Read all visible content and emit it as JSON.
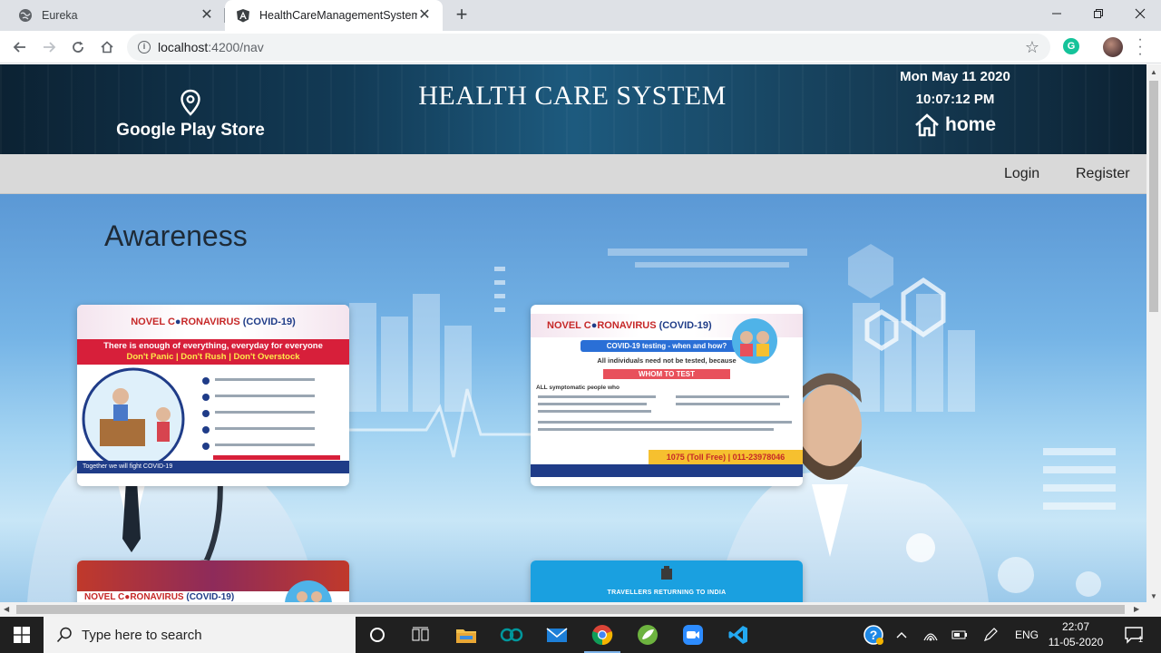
{
  "browser": {
    "tabs": [
      {
        "title": "Eureka",
        "active": false
      },
      {
        "title": "HealthCareManagementSystem",
        "active": true
      }
    ],
    "address": {
      "host": "localhost",
      "path": ":4200/nav"
    },
    "extension_letter": "G"
  },
  "header": {
    "store_label": "Google Play Store",
    "site_title": "HEALTH CARE SYSTEM",
    "date": "Mon May 11 2020",
    "time": "10:07:12 PM",
    "home_label": "home"
  },
  "nav": {
    "login": "Login",
    "register": "Register"
  },
  "main": {
    "heading": "Awareness",
    "posters": [
      {
        "title_a": "NOVEL C",
        "title_b": "RONAVIRUS",
        "subtitle": "(COVID-19)",
        "line1": "There is enough of everything, everyday for everyone",
        "line2a": "Don't Panic",
        "line2b": "Don't Rush",
        "line2c": "Don't Overstock",
        "footer": "Together we will fight COVID-19"
      },
      {
        "title_a": "NOVEL C",
        "title_b": "RONAVIRUS",
        "subtitle": "(COVID-19)",
        "banner": "COVID-19 testing - when and how?",
        "line1": "All individuals need not be tested, because",
        "whom": "WHOM TO TEST",
        "line2": "ALL symptomatic people who",
        "helpline": "1075 (Toll Free) | 011-23978046"
      },
      {
        "title_a": "NOVEL C",
        "title_b": "RONAVIRUS",
        "subtitle": "(COVID-19)"
      },
      {
        "text": "TRAVELLERS RETURNING TO INDIA"
      }
    ]
  },
  "taskbar": {
    "search_placeholder": "Type here to search",
    "language": "ENG",
    "time": "22:07",
    "date": "11-05-2020",
    "notification_count": "1"
  },
  "colors": {
    "header_bg": "#123a55",
    "nav_bg": "#d9d9d9",
    "poster_red": "#d71f3a",
    "poster_blue": "#1f3c88"
  }
}
